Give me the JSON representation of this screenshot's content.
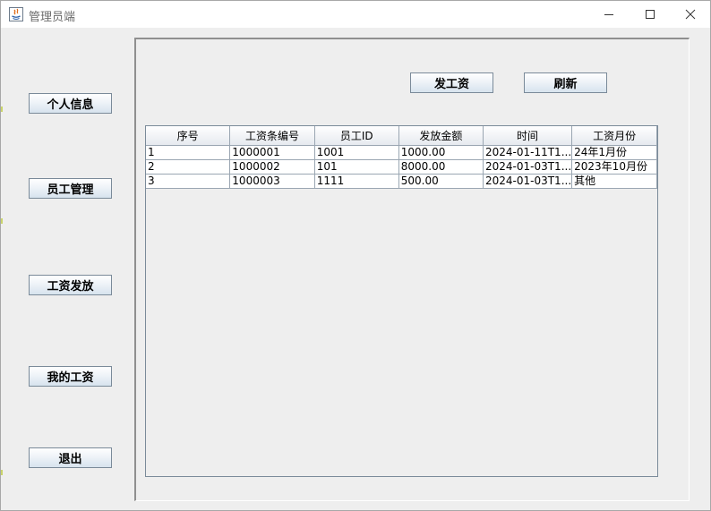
{
  "window": {
    "title": "管理员端"
  },
  "sidebar": {
    "items": [
      {
        "label": "个人信息"
      },
      {
        "label": "员工管理"
      },
      {
        "label": "工资发放"
      },
      {
        "label": "我的工资"
      },
      {
        "label": "退出"
      }
    ]
  },
  "toolbar": {
    "pay_label": "发工资",
    "refresh_label": "刷新"
  },
  "table": {
    "columns": [
      "序号",
      "工资条编号",
      "员工ID",
      "发放金额",
      "时间",
      "工资月份"
    ],
    "rows": [
      [
        "1",
        "1000001",
        "1001",
        "1000.00",
        "2024-01-11T1...",
        "24年1月份"
      ],
      [
        "2",
        "1000002",
        "101",
        "8000.00",
        "2024-01-03T1...",
        "2023年10月份"
      ],
      [
        "3",
        "1000003",
        "1111",
        "500.00",
        "2024-01-03T1...",
        "其他"
      ]
    ]
  }
}
